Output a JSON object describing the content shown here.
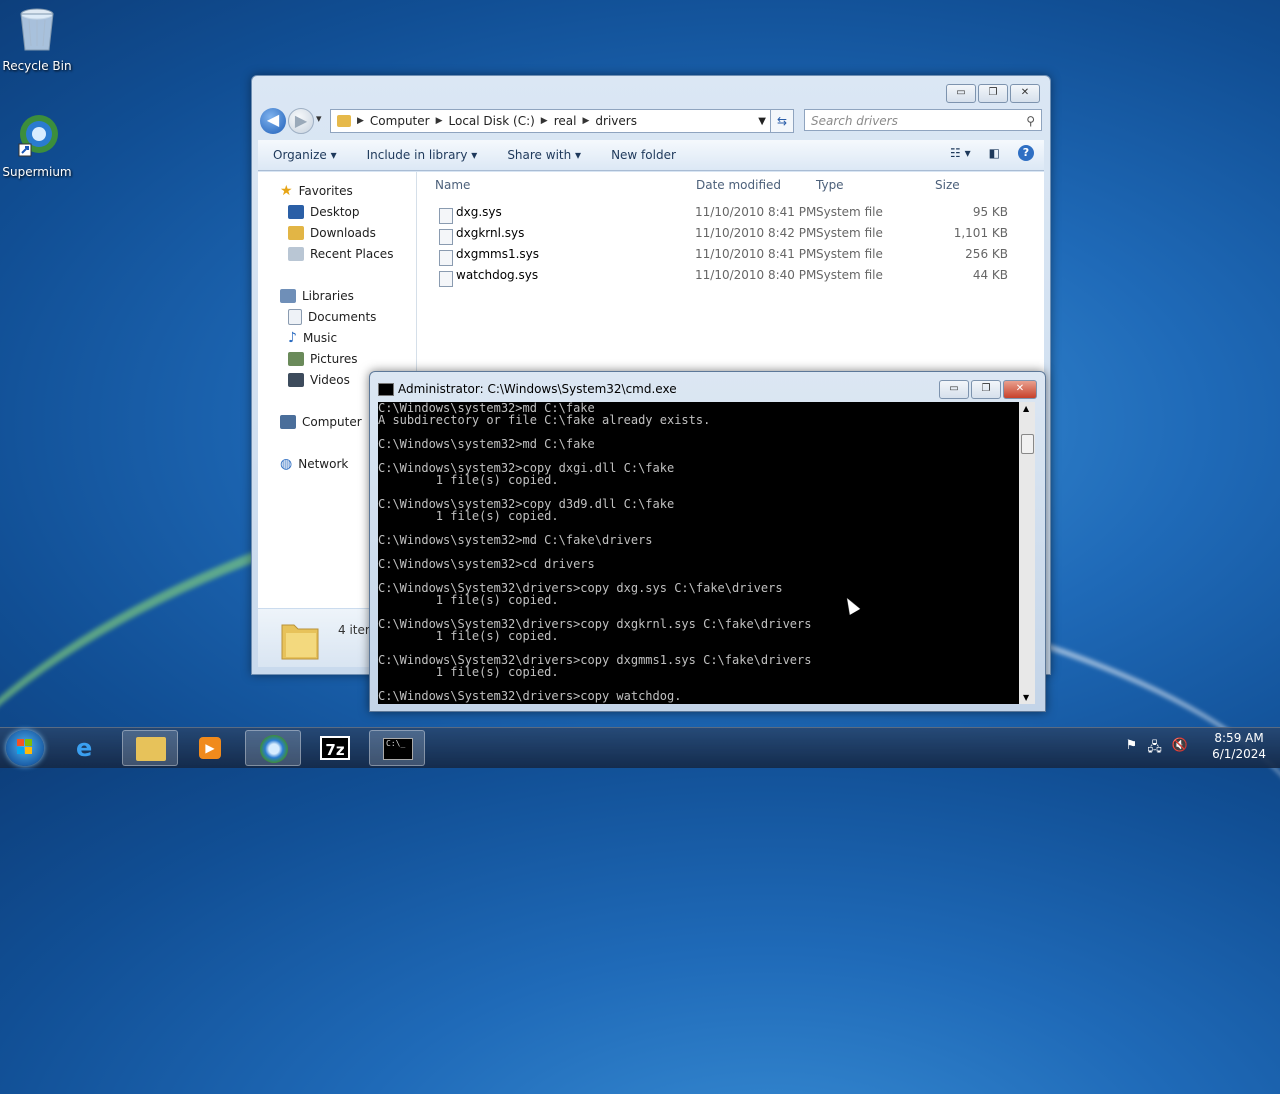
{
  "desktop": {
    "icons": [
      {
        "label": "Recycle Bin",
        "icon": "recycle-bin-icon"
      },
      {
        "label": "Supermium",
        "icon": "supermium-icon"
      }
    ]
  },
  "explorer": {
    "window_buttons": {
      "minimize": "▭",
      "maximize": "❐",
      "close": "✕"
    },
    "nav": {
      "back": "◀",
      "forward": "▶",
      "dropdown": "▾"
    },
    "address": {
      "root_icon": "folder-icon",
      "parts": [
        "Computer",
        "Local Disk (C:)",
        "real",
        "drivers"
      ]
    },
    "search_placeholder": "Search drivers",
    "toolbar": {
      "organize": "Organize ▾",
      "include_in_library": "Include in library ▾",
      "share_with": "Share with ▾",
      "new_folder": "New folder"
    },
    "nav_pane": {
      "favorites": "Favorites",
      "desktop": "Desktop",
      "downloads": "Downloads",
      "recent_places": "Recent Places",
      "libraries": "Libraries",
      "documents": "Documents",
      "music": "Music",
      "pictures": "Pictures",
      "videos": "Videos",
      "computer": "Computer",
      "network": "Network"
    },
    "columns": {
      "name": "Name",
      "date_modified": "Date modified",
      "type": "Type",
      "size": "Size"
    },
    "files": [
      {
        "name": "dxg.sys",
        "date": "11/10/2010 8:41 PM",
        "type": "System file",
        "size": "95 KB"
      },
      {
        "name": "dxgkrnl.sys",
        "date": "11/10/2010 8:42 PM",
        "type": "System file",
        "size": "1,101 KB"
      },
      {
        "name": "dxgmms1.sys",
        "date": "11/10/2010 8:41 PM",
        "type": "System file",
        "size": "256 KB"
      },
      {
        "name": "watchdog.sys",
        "date": "11/10/2010 8:40 PM",
        "type": "System file",
        "size": "44 KB"
      }
    ],
    "status_text": "4 item"
  },
  "cmd": {
    "title": "Administrator: C:\\Windows\\System32\\cmd.exe",
    "lines": [
      "C:\\Windows\\system32>md C:\\fake",
      "A subdirectory or file C:\\fake already exists.",
      "",
      "C:\\Windows\\system32>md C:\\fake",
      "",
      "C:\\Windows\\system32>copy dxgi.dll C:\\fake",
      "        1 file(s) copied.",
      "",
      "C:\\Windows\\system32>copy d3d9.dll C:\\fake",
      "        1 file(s) copied.",
      "",
      "C:\\Windows\\system32>md C:\\fake\\drivers",
      "",
      "C:\\Windows\\system32>cd drivers",
      "",
      "C:\\Windows\\System32\\drivers>copy dxg.sys C:\\fake\\drivers",
      "        1 file(s) copied.",
      "",
      "C:\\Windows\\System32\\drivers>copy dxgkrnl.sys C:\\fake\\drivers",
      "        1 file(s) copied.",
      "",
      "C:\\Windows\\System32\\drivers>copy dxgmms1.sys C:\\fake\\drivers",
      "        1 file(s) copied.",
      "",
      "C:\\Windows\\System32\\drivers>copy watchdog."
    ]
  },
  "taskbar": {
    "apps": [
      "internet-explorer-icon",
      "file-explorer-icon",
      "media-player-icon",
      "supermium-icon",
      "7zip-icon",
      "cmd-icon"
    ],
    "zip_label": "7z",
    "cmd_label": "C:\\_",
    "time": "8:59 AM",
    "date": "6/1/2024"
  }
}
